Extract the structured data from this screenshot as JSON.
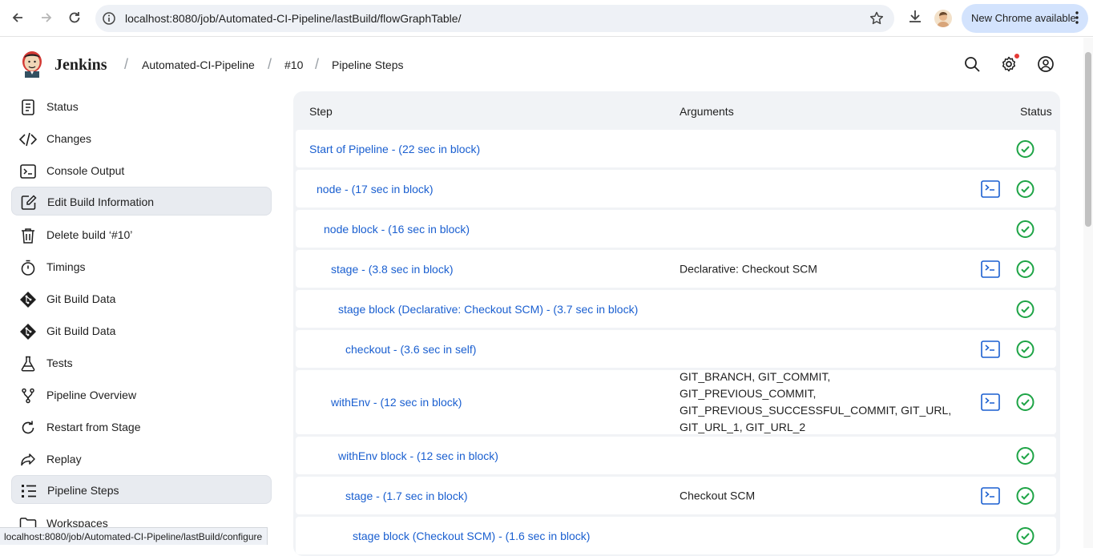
{
  "browser": {
    "url": "localhost:8080/job/Automated-CI-Pipeline/lastBuild/flowGraphTable/",
    "update_label": "New Chrome available",
    "status_url": "localhost:8080/job/Automated-CI-Pipeline/lastBuild/configure"
  },
  "header": {
    "app_name": "Jenkins",
    "breadcrumbs": [
      "Automated-CI-Pipeline",
      "#10",
      "Pipeline Steps"
    ]
  },
  "sidebar": {
    "items": [
      {
        "label": "Status",
        "icon": "document-icon"
      },
      {
        "label": "Changes",
        "icon": "code-icon"
      },
      {
        "label": "Console Output",
        "icon": "terminal-icon"
      },
      {
        "label": "Edit Build Information",
        "icon": "edit-icon"
      },
      {
        "label": "Delete build ‘#10’",
        "icon": "trash-icon"
      },
      {
        "label": "Timings",
        "icon": "stopwatch-icon"
      },
      {
        "label": "Git Build Data",
        "icon": "git-icon"
      },
      {
        "label": "Git Build Data",
        "icon": "git-icon"
      },
      {
        "label": "Tests",
        "icon": "flask-icon"
      },
      {
        "label": "Pipeline Overview",
        "icon": "branch-icon"
      },
      {
        "label": "Restart from Stage",
        "icon": "restart-icon"
      },
      {
        "label": "Replay",
        "icon": "replay-icon"
      },
      {
        "label": "Pipeline Steps",
        "icon": "steps-icon"
      },
      {
        "label": "Workspaces",
        "icon": "folder-icon"
      }
    ]
  },
  "table": {
    "columns": [
      "Step",
      "Arguments",
      "Status"
    ],
    "rows": [
      {
        "step": "Start of Pipeline - (22 sec in block)",
        "args": "",
        "console": false,
        "status": "success"
      },
      {
        "step": "node - (17 sec in block)",
        "args": "",
        "console": true,
        "status": "success"
      },
      {
        "step": "node block - (16 sec in block)",
        "args": "",
        "console": false,
        "status": "success"
      },
      {
        "step": "stage - (3.8 sec in block)",
        "args": "Declarative: Checkout SCM",
        "console": true,
        "status": "success"
      },
      {
        "step": "stage block (Declarative: Checkout SCM) - (3.7 sec in block)",
        "args": "",
        "console": false,
        "status": "success"
      },
      {
        "step": "checkout - (3.6 sec in self)",
        "args": "",
        "console": true,
        "status": "success"
      },
      {
        "step": "withEnv - (12 sec in block)",
        "args": "GIT_BRANCH, GIT_COMMIT, GIT_PREVIOUS_COMMIT, GIT_PREVIOUS_SUCCESSFUL_COMMIT, GIT_URL, GIT_URL_1, GIT_URL_2",
        "console": true,
        "status": "success"
      },
      {
        "step": "withEnv block - (12 sec in block)",
        "args": "",
        "console": false,
        "status": "success"
      },
      {
        "step": "stage - (1.7 sec in block)",
        "args": "Checkout SCM",
        "console": true,
        "status": "success"
      },
      {
        "step": "stage block (Checkout SCM) - (1.6 sec in block)",
        "args": "",
        "console": false,
        "status": "success"
      }
    ]
  }
}
